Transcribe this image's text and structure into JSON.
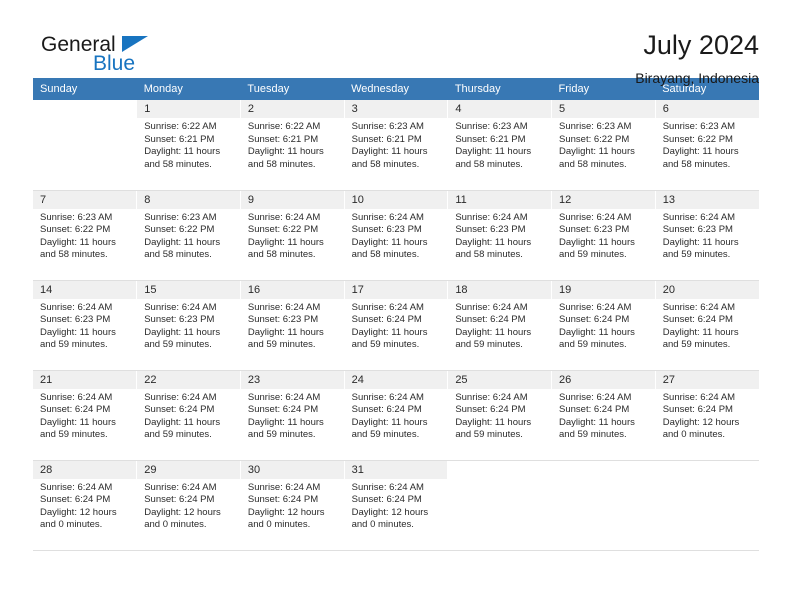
{
  "brand": {
    "name_top": "General",
    "name_bottom": "Blue",
    "accent_color": "#1874c0",
    "triangle_icon": "triangle-icon"
  },
  "header": {
    "month_title": "July 2024",
    "location": "Birayang, Indonesia"
  },
  "calendar": {
    "header_bg": "#3878b4",
    "daynum_bg": "#f0f0f0",
    "weekday_headers": [
      "Sunday",
      "Monday",
      "Tuesday",
      "Wednesday",
      "Thursday",
      "Friday",
      "Saturday"
    ],
    "labels": {
      "sunrise_prefix": "Sunrise:",
      "sunset_prefix": "Sunset:",
      "daylight_prefix": "Daylight:"
    },
    "weeks": [
      [
        {
          "day": "",
          "sunrise": "",
          "sunset": "",
          "daylight": "",
          "empty": true
        },
        {
          "day": "1",
          "sunrise": "Sunrise: 6:22 AM",
          "sunset": "Sunset: 6:21 PM",
          "daylight": "Daylight: 11 hours and 58 minutes."
        },
        {
          "day": "2",
          "sunrise": "Sunrise: 6:22 AM",
          "sunset": "Sunset: 6:21 PM",
          "daylight": "Daylight: 11 hours and 58 minutes."
        },
        {
          "day": "3",
          "sunrise": "Sunrise: 6:23 AM",
          "sunset": "Sunset: 6:21 PM",
          "daylight": "Daylight: 11 hours and 58 minutes."
        },
        {
          "day": "4",
          "sunrise": "Sunrise: 6:23 AM",
          "sunset": "Sunset: 6:21 PM",
          "daylight": "Daylight: 11 hours and 58 minutes."
        },
        {
          "day": "5",
          "sunrise": "Sunrise: 6:23 AM",
          "sunset": "Sunset: 6:22 PM",
          "daylight": "Daylight: 11 hours and 58 minutes."
        },
        {
          "day": "6",
          "sunrise": "Sunrise: 6:23 AM",
          "sunset": "Sunset: 6:22 PM",
          "daylight": "Daylight: 11 hours and 58 minutes."
        }
      ],
      [
        {
          "day": "7",
          "sunrise": "Sunrise: 6:23 AM",
          "sunset": "Sunset: 6:22 PM",
          "daylight": "Daylight: 11 hours and 58 minutes."
        },
        {
          "day": "8",
          "sunrise": "Sunrise: 6:23 AM",
          "sunset": "Sunset: 6:22 PM",
          "daylight": "Daylight: 11 hours and 58 minutes."
        },
        {
          "day": "9",
          "sunrise": "Sunrise: 6:24 AM",
          "sunset": "Sunset: 6:22 PM",
          "daylight": "Daylight: 11 hours and 58 minutes."
        },
        {
          "day": "10",
          "sunrise": "Sunrise: 6:24 AM",
          "sunset": "Sunset: 6:23 PM",
          "daylight": "Daylight: 11 hours and 58 minutes."
        },
        {
          "day": "11",
          "sunrise": "Sunrise: 6:24 AM",
          "sunset": "Sunset: 6:23 PM",
          "daylight": "Daylight: 11 hours and 58 minutes."
        },
        {
          "day": "12",
          "sunrise": "Sunrise: 6:24 AM",
          "sunset": "Sunset: 6:23 PM",
          "daylight": "Daylight: 11 hours and 59 minutes."
        },
        {
          "day": "13",
          "sunrise": "Sunrise: 6:24 AM",
          "sunset": "Sunset: 6:23 PM",
          "daylight": "Daylight: 11 hours and 59 minutes."
        }
      ],
      [
        {
          "day": "14",
          "sunrise": "Sunrise: 6:24 AM",
          "sunset": "Sunset: 6:23 PM",
          "daylight": "Daylight: 11 hours and 59 minutes."
        },
        {
          "day": "15",
          "sunrise": "Sunrise: 6:24 AM",
          "sunset": "Sunset: 6:23 PM",
          "daylight": "Daylight: 11 hours and 59 minutes."
        },
        {
          "day": "16",
          "sunrise": "Sunrise: 6:24 AM",
          "sunset": "Sunset: 6:23 PM",
          "daylight": "Daylight: 11 hours and 59 minutes."
        },
        {
          "day": "17",
          "sunrise": "Sunrise: 6:24 AM",
          "sunset": "Sunset: 6:24 PM",
          "daylight": "Daylight: 11 hours and 59 minutes."
        },
        {
          "day": "18",
          "sunrise": "Sunrise: 6:24 AM",
          "sunset": "Sunset: 6:24 PM",
          "daylight": "Daylight: 11 hours and 59 minutes."
        },
        {
          "day": "19",
          "sunrise": "Sunrise: 6:24 AM",
          "sunset": "Sunset: 6:24 PM",
          "daylight": "Daylight: 11 hours and 59 minutes."
        },
        {
          "day": "20",
          "sunrise": "Sunrise: 6:24 AM",
          "sunset": "Sunset: 6:24 PM",
          "daylight": "Daylight: 11 hours and 59 minutes."
        }
      ],
      [
        {
          "day": "21",
          "sunrise": "Sunrise: 6:24 AM",
          "sunset": "Sunset: 6:24 PM",
          "daylight": "Daylight: 11 hours and 59 minutes."
        },
        {
          "day": "22",
          "sunrise": "Sunrise: 6:24 AM",
          "sunset": "Sunset: 6:24 PM",
          "daylight": "Daylight: 11 hours and 59 minutes."
        },
        {
          "day": "23",
          "sunrise": "Sunrise: 6:24 AM",
          "sunset": "Sunset: 6:24 PM",
          "daylight": "Daylight: 11 hours and 59 minutes."
        },
        {
          "day": "24",
          "sunrise": "Sunrise: 6:24 AM",
          "sunset": "Sunset: 6:24 PM",
          "daylight": "Daylight: 11 hours and 59 minutes."
        },
        {
          "day": "25",
          "sunrise": "Sunrise: 6:24 AM",
          "sunset": "Sunset: 6:24 PM",
          "daylight": "Daylight: 11 hours and 59 minutes."
        },
        {
          "day": "26",
          "sunrise": "Sunrise: 6:24 AM",
          "sunset": "Sunset: 6:24 PM",
          "daylight": "Daylight: 11 hours and 59 minutes."
        },
        {
          "day": "27",
          "sunrise": "Sunrise: 6:24 AM",
          "sunset": "Sunset: 6:24 PM",
          "daylight": "Daylight: 12 hours and 0 minutes."
        }
      ],
      [
        {
          "day": "28",
          "sunrise": "Sunrise: 6:24 AM",
          "sunset": "Sunset: 6:24 PM",
          "daylight": "Daylight: 12 hours and 0 minutes."
        },
        {
          "day": "29",
          "sunrise": "Sunrise: 6:24 AM",
          "sunset": "Sunset: 6:24 PM",
          "daylight": "Daylight: 12 hours and 0 minutes."
        },
        {
          "day": "30",
          "sunrise": "Sunrise: 6:24 AM",
          "sunset": "Sunset: 6:24 PM",
          "daylight": "Daylight: 12 hours and 0 minutes."
        },
        {
          "day": "31",
          "sunrise": "Sunrise: 6:24 AM",
          "sunset": "Sunset: 6:24 PM",
          "daylight": "Daylight: 12 hours and 0 minutes."
        },
        {
          "day": "",
          "sunrise": "",
          "sunset": "",
          "daylight": "",
          "empty": true
        },
        {
          "day": "",
          "sunrise": "",
          "sunset": "",
          "daylight": "",
          "empty": true
        },
        {
          "day": "",
          "sunrise": "",
          "sunset": "",
          "daylight": "",
          "empty": true
        }
      ]
    ]
  }
}
